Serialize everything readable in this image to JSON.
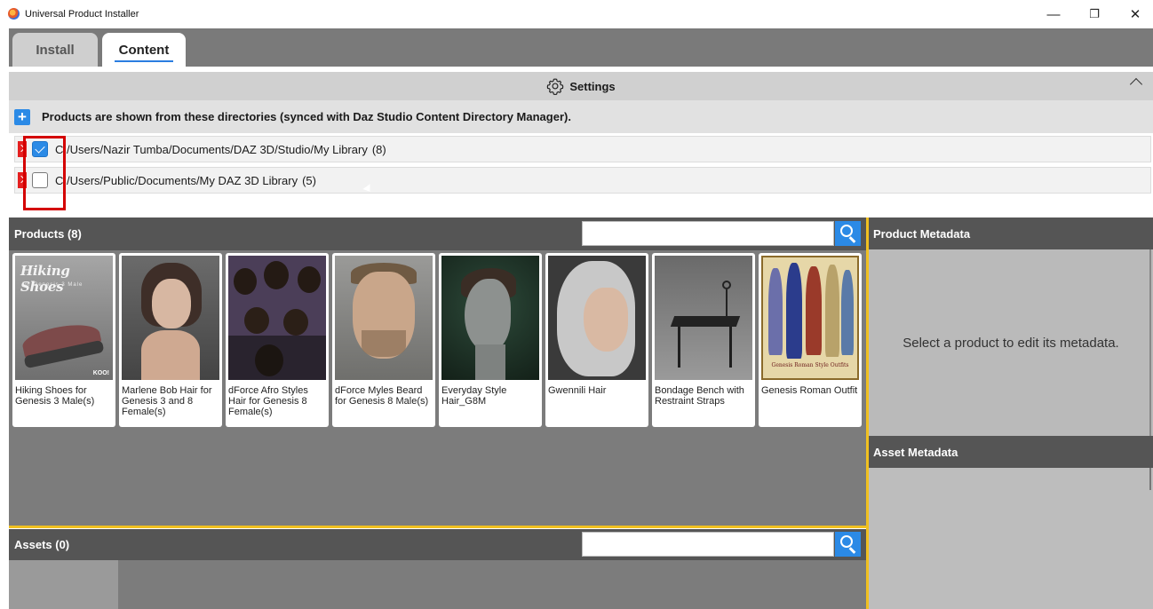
{
  "window": {
    "title": "Universal Product Installer",
    "minimize": "—",
    "restore": "❐",
    "close": "✕"
  },
  "tabs": [
    {
      "label": "Install",
      "active": false
    },
    {
      "label": "Content",
      "active": true
    }
  ],
  "settings": {
    "title": "Settings",
    "info": "Products are shown from these directories (synced with Daz Studio Content Directory Manager).",
    "add_label": "+"
  },
  "directories": [
    {
      "path": "C:/Users/Nazir Tumba/Documents/DAZ 3D/Studio/My Library",
      "count": "(8)",
      "checked": true
    },
    {
      "path": "C:/Users/Public/Documents/My DAZ 3D Library",
      "count": "(5)",
      "checked": false
    }
  ],
  "products": {
    "header": "Products (8)",
    "search_value": "",
    "items": [
      {
        "label": "Hiking Shoes for Genesis 3 Male(s)",
        "thumb_title": "Hiking Shoes",
        "thumb_subtitle": "for Genesis 3 Male",
        "thumb_brand": "KOO!"
      },
      {
        "label": "Marlene Bob Hair for Genesis 3 and 8 Female(s)"
      },
      {
        "label": "dForce Afro Styles Hair for Genesis 8 Female(s)"
      },
      {
        "label": "dForce Myles Beard for Genesis 8 Male(s)"
      },
      {
        "label": "Everyday Style Hair_G8M"
      },
      {
        "label": "Gwennili Hair"
      },
      {
        "label": "Bondage Bench with Restraint Straps"
      },
      {
        "label": "Genesis Roman Outfit",
        "thumb_caption": "Genesis Roman Style Outfits"
      }
    ]
  },
  "assets": {
    "header": "Assets (0)",
    "search_value": ""
  },
  "metadata": {
    "product_header": "Product Metadata",
    "product_placeholder": "Select a product to edit its metadata.",
    "asset_header": "Asset Metadata"
  },
  "colors": {
    "accent": "#2b8ae6",
    "highlight": "#d40000",
    "divider": "#f0c020"
  }
}
